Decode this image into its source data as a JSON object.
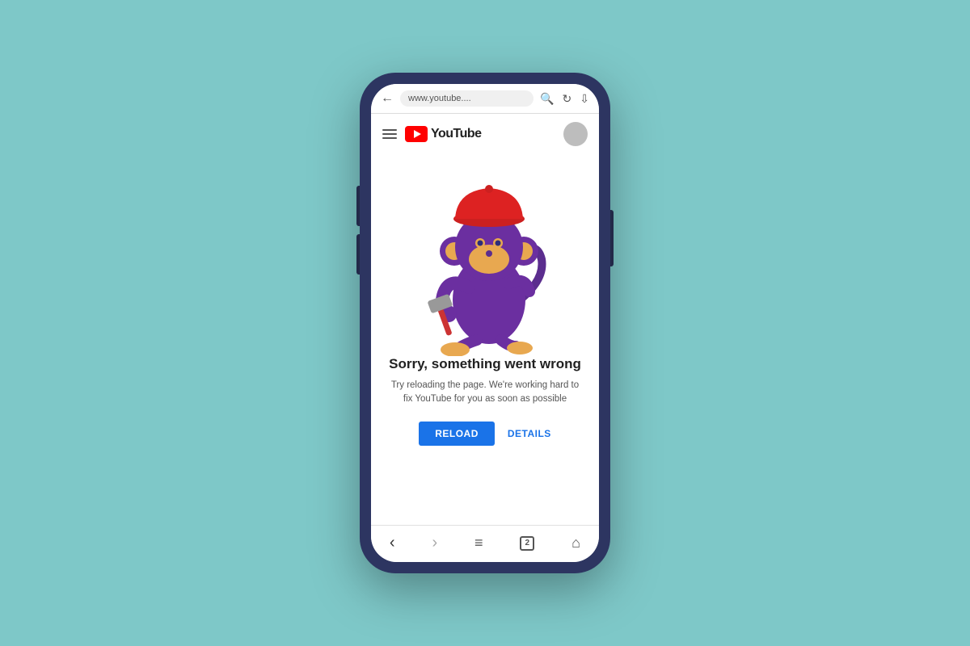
{
  "background": {
    "color": "#7ec8c8"
  },
  "phone": {
    "browser": {
      "url": "www.youtube....",
      "back_icon": "←",
      "search_icon": "🔍",
      "refresh_icon": "↻",
      "download_icon": "⬇"
    },
    "youtube_header": {
      "logo_text": "YouTube",
      "hamburger_label": "menu"
    },
    "error_page": {
      "title": "Sorry, something went wrong",
      "subtitle": "Try reloading the page. We're working hard to fix YouTube\nfor you as soon as possible",
      "reload_button": "RELOAD",
      "details_button": "DETAILS"
    },
    "bottom_nav": {
      "back": "‹",
      "forward": "›",
      "menu": "≡",
      "tabs_count": "2",
      "home": "⌂"
    }
  }
}
